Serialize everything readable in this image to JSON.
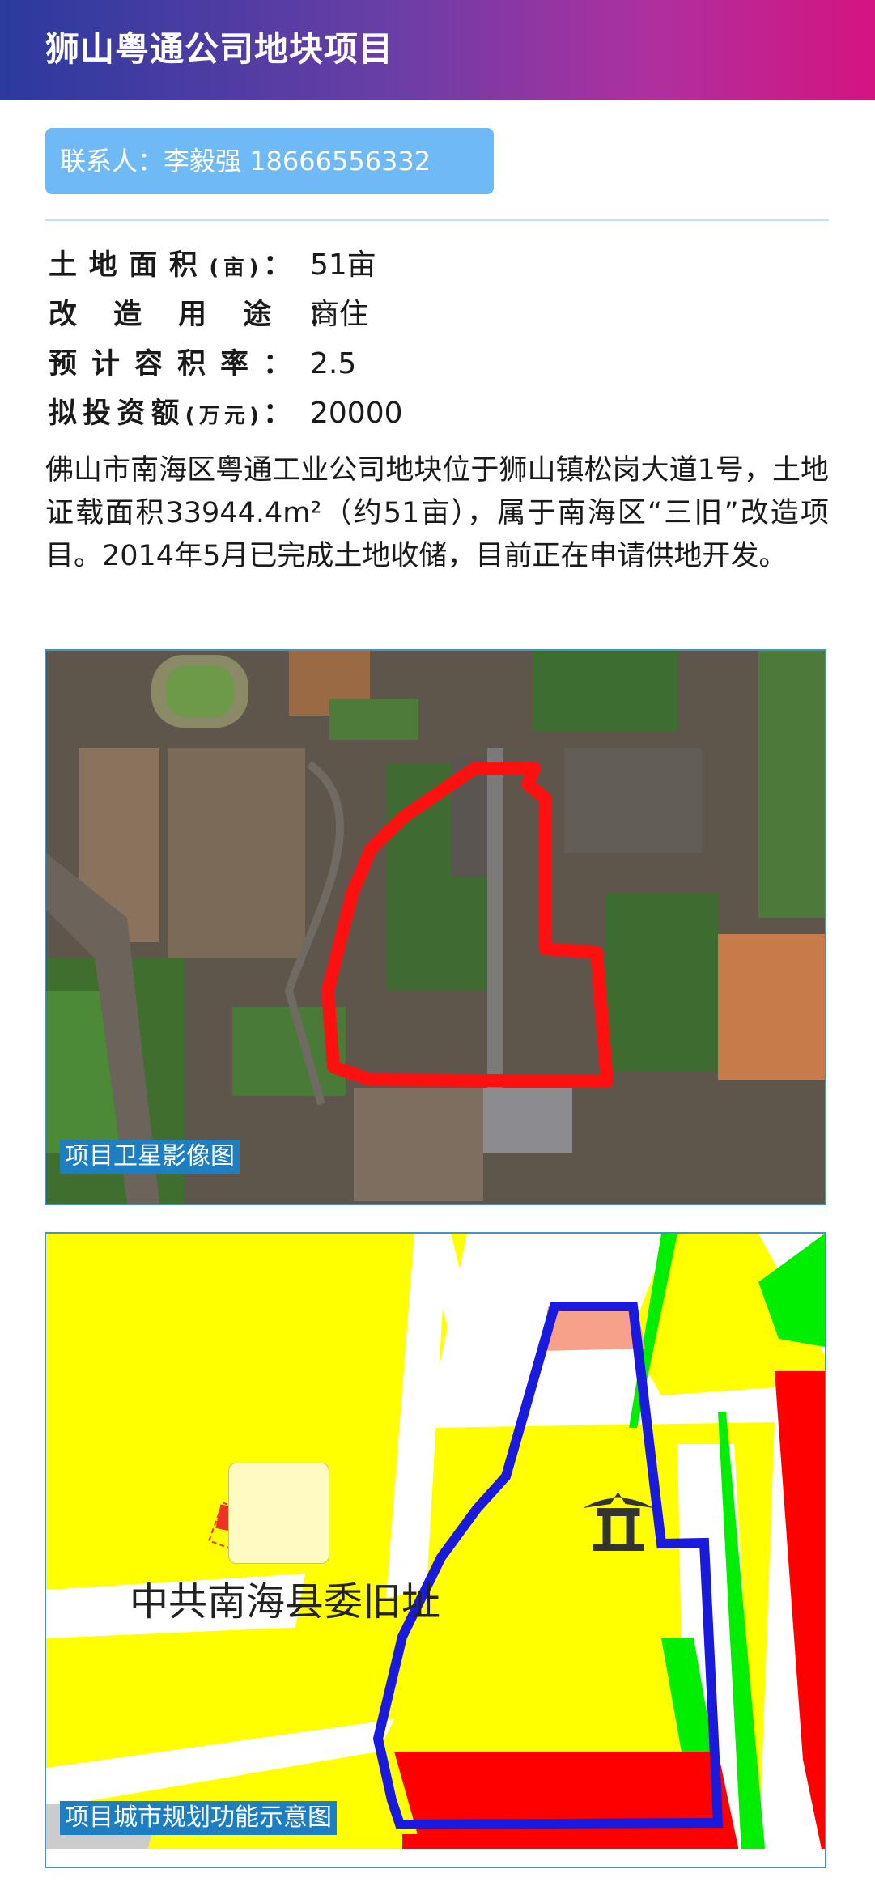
{
  "header": {
    "title": "狮山粤通公司地块项目"
  },
  "contact": {
    "text": "联系人：李毅强  18666556332"
  },
  "facts": [
    {
      "label": "土地面积",
      "label_suffix": "(亩)",
      "sep": "：",
      "value": "51亩"
    },
    {
      "label": "改造用途",
      "label_suffix": "",
      "sep": "：",
      "value": "商住"
    },
    {
      "label": "预计容积率",
      "label_suffix": "",
      "sep": "：",
      "value": "2.5"
    },
    {
      "label": "拟投资额",
      "label_suffix": "(万元)",
      "sep": "：",
      "value": "20000"
    }
  ],
  "description": "佛山市南海区粤通工业公司地块位于狮山镇松岗大道1号，土地证载面积33944.4m²（约51亩），属于南海区“三旧”改造项目。2014年5月已完成土地收储，目前正在申请供地开发。",
  "satellite": {
    "caption": "项目卫星影像图",
    "boundary_color": "#ff1010"
  },
  "plan_map": {
    "caption": "项目城市规划功能示意图",
    "poi_label": "中共南海县委旧址",
    "boundary_color": "#1a1adf",
    "colors": {
      "residential": "#ffff00",
      "commercial": "#ff0000",
      "green": "#00ee00",
      "public": "#f7a08a"
    }
  }
}
